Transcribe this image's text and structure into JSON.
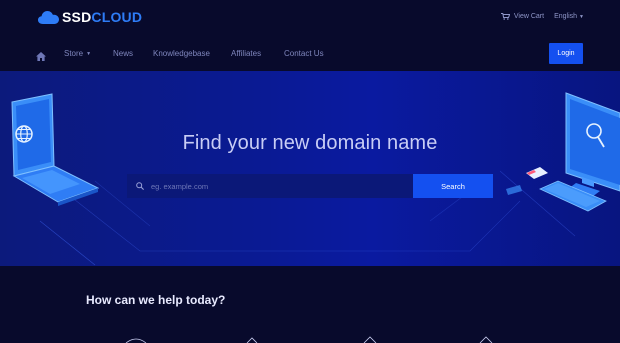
{
  "brand": {
    "part1": "SSD",
    "part2": "CLOUD"
  },
  "topbar": {
    "cart_label": "View Cart",
    "language": "English"
  },
  "nav": {
    "items": [
      {
        "label": "Store",
        "dropdown": true
      },
      {
        "label": "News"
      },
      {
        "label": "Knowledgebase"
      },
      {
        "label": "Affiliates"
      },
      {
        "label": "Contact Us"
      }
    ],
    "login_label": "Login"
  },
  "hero": {
    "title": "Find your new domain name",
    "search_placeholder": "eg. example.com",
    "search_button": "Search"
  },
  "help": {
    "title": "How can we help today?"
  },
  "colors": {
    "accent": "#1450f0",
    "brand_blue": "#2e7cf6",
    "background": "#080a2c",
    "hero": "#0a1a92"
  },
  "icons": [
    "cloud-logo-icon",
    "cart-icon",
    "home-icon",
    "search-icon",
    "globe-icon",
    "magnifier-icon"
  ]
}
